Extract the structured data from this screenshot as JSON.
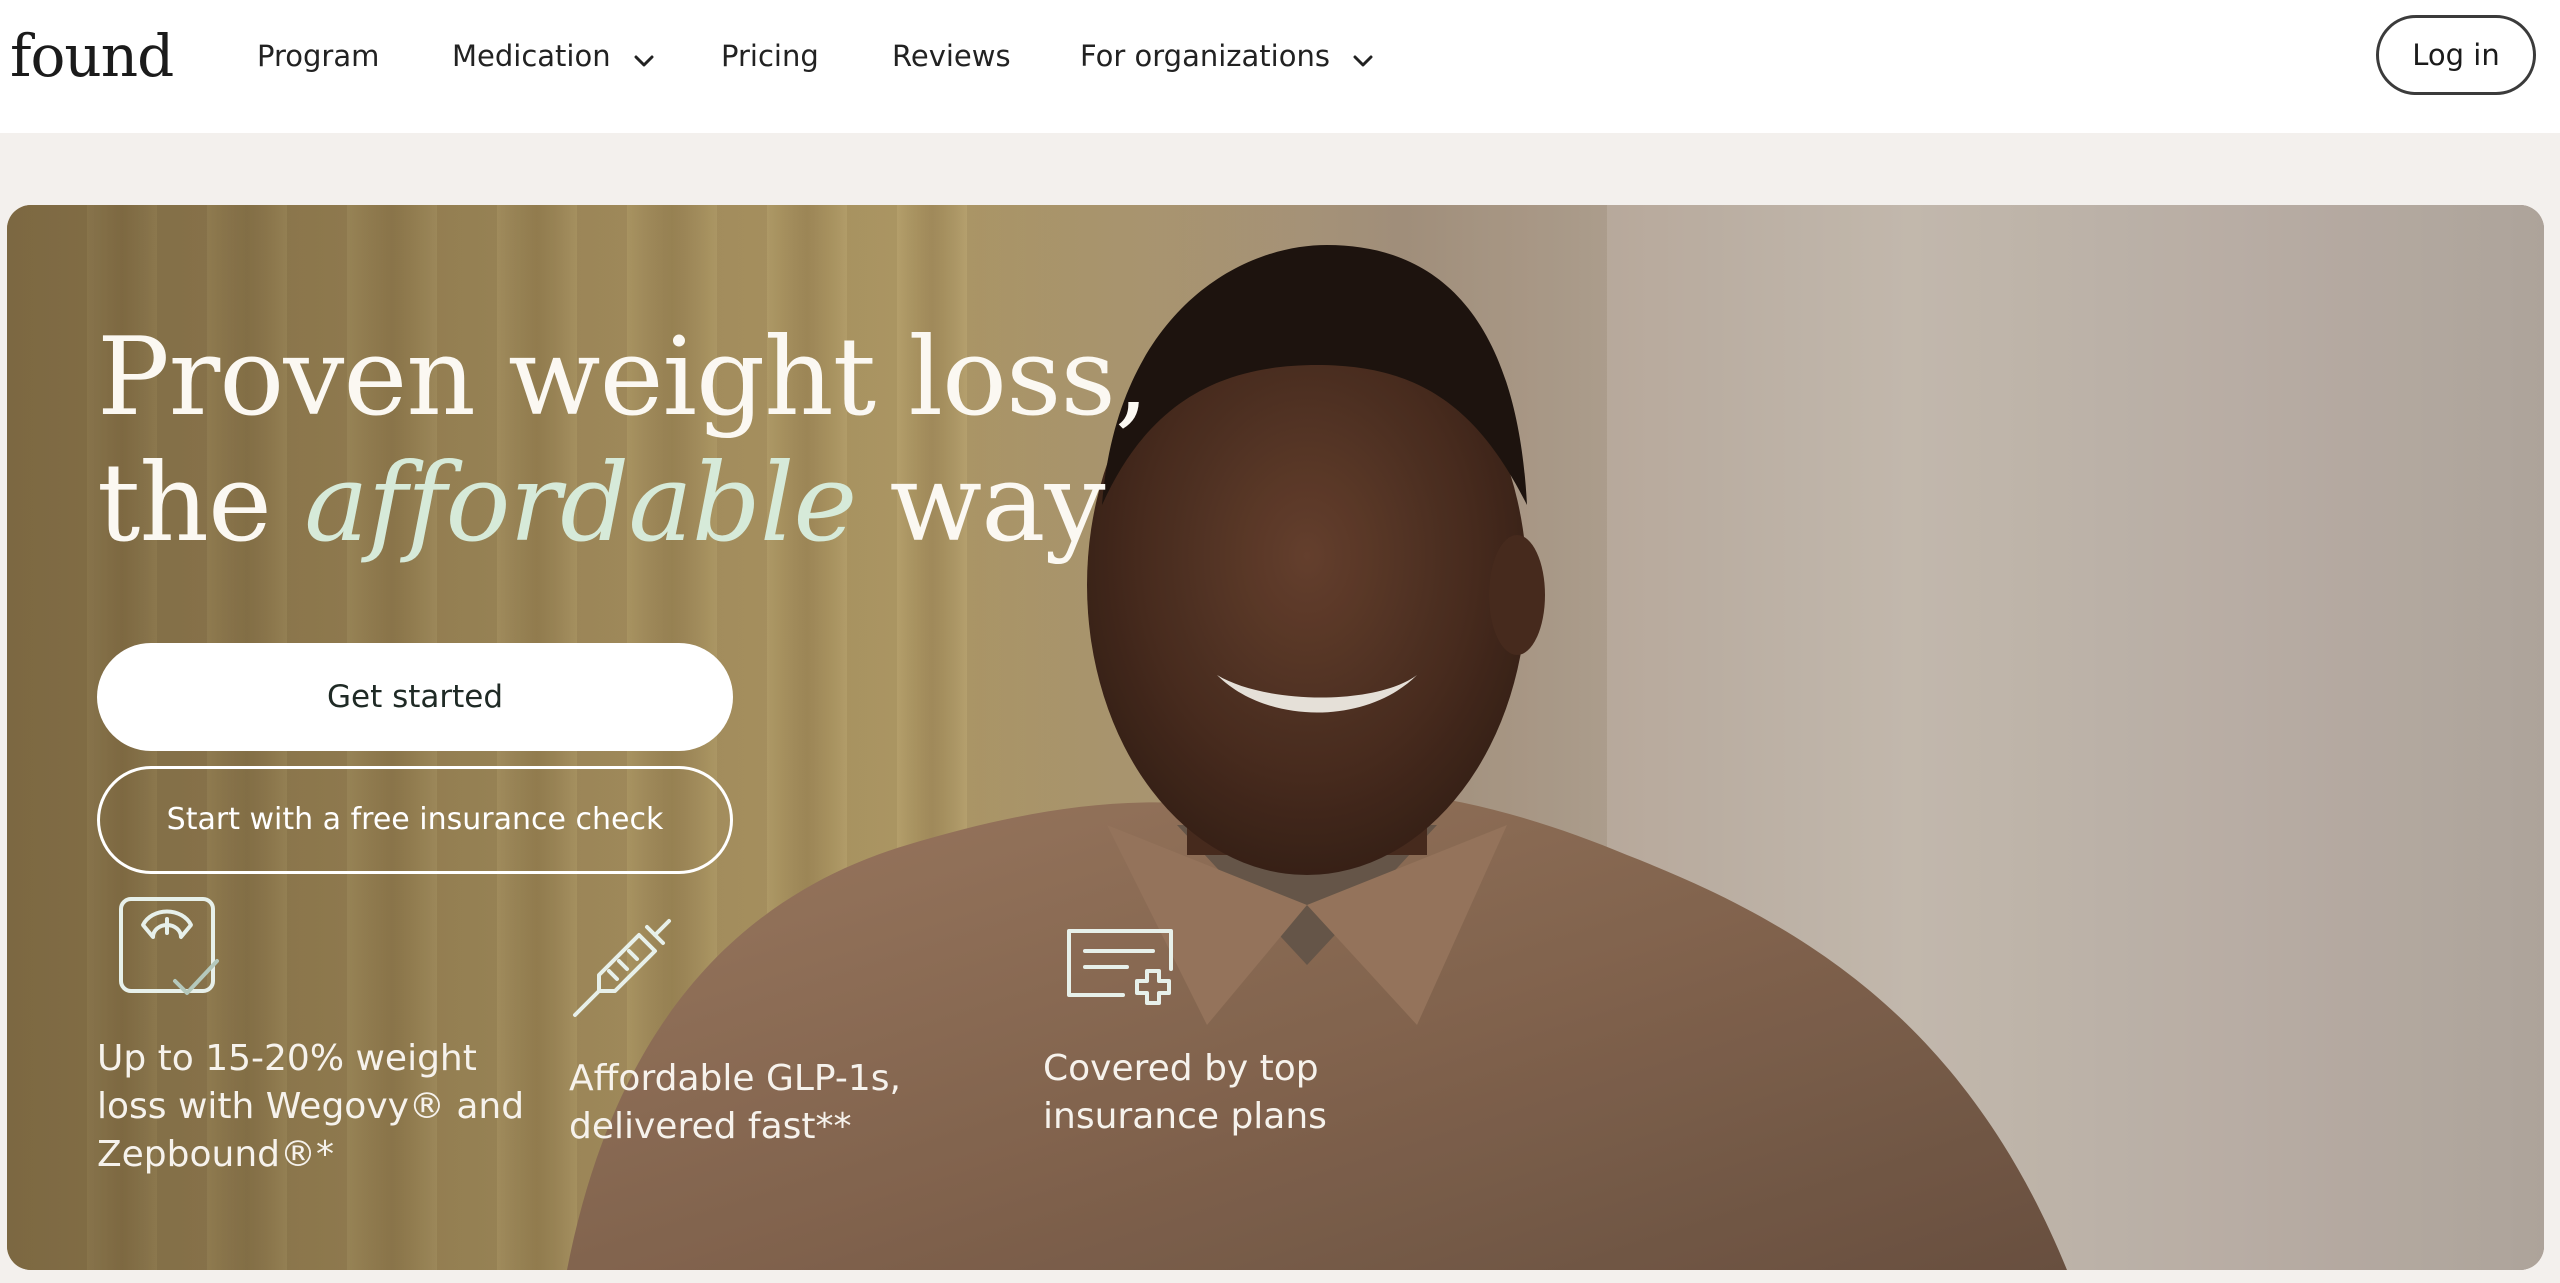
{
  "nav": {
    "logo": "found",
    "items": [
      {
        "label": "Program",
        "has_dropdown": false
      },
      {
        "label": "Medication",
        "has_dropdown": true
      },
      {
        "label": "Pricing",
        "has_dropdown": false
      },
      {
        "label": "Reviews",
        "has_dropdown": false
      },
      {
        "label": "For organizations",
        "has_dropdown": true
      }
    ],
    "login_label": "Log in"
  },
  "hero": {
    "title_line1": "Proven weight loss,",
    "title_line2_pre": "the ",
    "title_line2_accent": "affordable",
    "title_line2_post": " way",
    "primary_cta": "Get started",
    "secondary_cta": "Start with a free insurance check",
    "features": [
      {
        "icon": "scale-check-icon",
        "text": "Up to 15-20% weight loss with Wegovy® and Zepbound®*"
      },
      {
        "icon": "syringe-icon",
        "text": "Affordable GLP-1s, delivered fast**"
      },
      {
        "icon": "insurance-card-plus-icon",
        "text": "Covered by top insurance plans"
      }
    ]
  },
  "colors": {
    "nav_bg": "#ffffff",
    "page_bg": "#f3f0ed",
    "hero_text": "#fbf8f2",
    "accent_text": "#d6ead9"
  }
}
